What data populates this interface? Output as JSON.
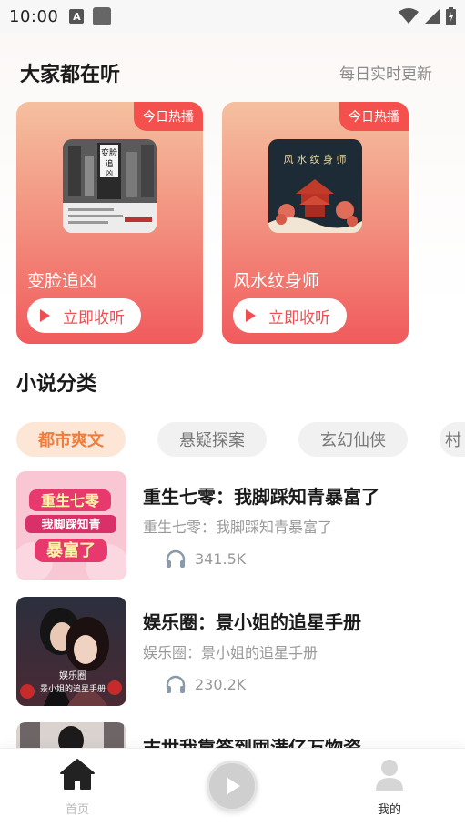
{
  "status_bar": {
    "time": "10:00",
    "a_icon_letter": "A"
  },
  "popular": {
    "title": "大家都在听",
    "subtitle": "每日实时更新",
    "cards": [
      {
        "badge": "今日热播",
        "name": "变脸追凶",
        "button_label": "立即收听",
        "cover_icon": "book-cover-crime"
      },
      {
        "badge": "今日热播",
        "name": "风水纹身师",
        "button_label": "立即收听",
        "cover_icon": "book-cover-temple"
      }
    ]
  },
  "categories": {
    "title": "小说分类",
    "tabs": [
      "都市爽文",
      "悬疑探案",
      "玄幻仙侠",
      "村"
    ],
    "active_index": 0
  },
  "books": [
    {
      "title": "重生七零：我脚踩知青暴富了",
      "desc": "重生七零：我脚踩知青暴富了",
      "plays": "341.5K"
    },
    {
      "title": "娱乐圈：景小姐的追星手册",
      "desc": "娱乐圈：景小姐的追星手册",
      "plays": "230.2K"
    },
    {
      "title": "末世我靠签到囤满亿万物资",
      "desc": "",
      "plays": ""
    }
  ],
  "tabbar": {
    "home_label": "首页",
    "me_label": "我的"
  },
  "colors": {
    "accent_red": "#f04f51",
    "accent_orange": "#ef7c3b",
    "badge": "#f3504e"
  }
}
